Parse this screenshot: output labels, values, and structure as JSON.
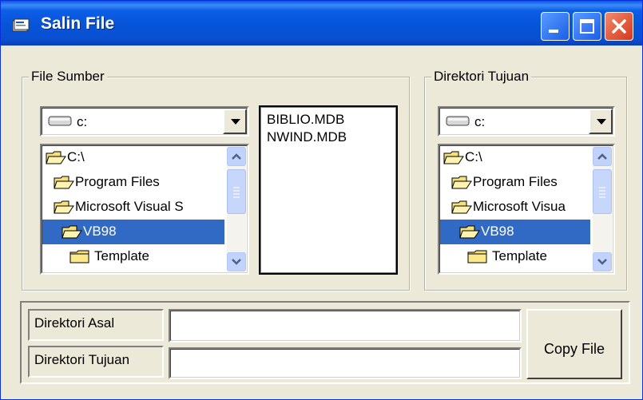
{
  "window": {
    "title": "Salin File",
    "icons": [
      "app-icon",
      "minimize-icon",
      "maximize-icon",
      "close-icon"
    ]
  },
  "source": {
    "group_label": "File Sumber",
    "drive": "c:",
    "directories": [
      {
        "label": "C:\\",
        "selected": false
      },
      {
        "label": "Program Files",
        "selected": false
      },
      {
        "label": "Microsoft Visual S",
        "selected": false
      },
      {
        "label": "VB98",
        "selected": true
      },
      {
        "label": "Template",
        "selected": false
      }
    ],
    "files": [
      "BIBLIO.MDB",
      "NWIND.MDB"
    ]
  },
  "destination": {
    "group_label": "Direktori Tujuan",
    "drive": "c:",
    "directories": [
      {
        "label": "C:\\",
        "selected": false
      },
      {
        "label": "Program Files",
        "selected": false
      },
      {
        "label": "Microsoft Visua",
        "selected": false
      },
      {
        "label": "VB98",
        "selected": true
      },
      {
        "label": "Template",
        "selected": false
      }
    ]
  },
  "fields": {
    "source_dir_label": "Direktori Asal",
    "source_dir_value": "",
    "dest_dir_label": "Direktori Tujuan",
    "dest_dir_value": ""
  },
  "actions": {
    "copy_label": "Copy File"
  },
  "colors": {
    "titlebar": "#0a56e6",
    "selection": "#316ac5",
    "face": "#ece9d8"
  }
}
